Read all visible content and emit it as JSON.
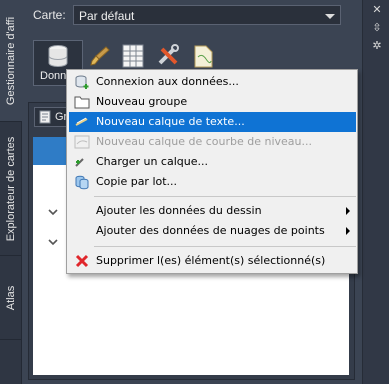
{
  "side_tabs": [
    {
      "label": "Gestionnaire d'affi"
    },
    {
      "label": "Explorateur de cartes"
    },
    {
      "label": "Atlas"
    }
  ],
  "map": {
    "label": "Carte:",
    "selected": "Par défaut"
  },
  "toolbar": {
    "data_button_label": "Donn",
    "group_button_label": "Gr"
  },
  "context_menu": {
    "items": [
      {
        "label": "Connexion aux données...",
        "icon": "database-connect-icon",
        "state": "normal"
      },
      {
        "label": "Nouveau groupe",
        "icon": "folder-icon",
        "state": "normal"
      },
      {
        "label": "Nouveau calque de texte...",
        "icon": "text-layer-icon",
        "state": "highlighted"
      },
      {
        "label": "Nouveau calque de courbe de niveau...",
        "icon": "contour-layer-icon",
        "state": "disabled"
      },
      {
        "label": "Charger un calque...",
        "icon": "load-layer-icon",
        "state": "normal"
      },
      {
        "label": "Copie par lot...",
        "icon": "batch-copy-icon",
        "state": "normal"
      },
      {
        "label": "Ajouter les données du dessin",
        "icon": "",
        "state": "submenu"
      },
      {
        "label": "Ajouter des données de nuages de points",
        "icon": "",
        "state": "submenu"
      },
      {
        "label": "Supprimer l(es) élément(s) sélectionné(s)",
        "icon": "delete-icon",
        "state": "normal"
      }
    ]
  },
  "colors": {
    "accent": "#0f73d4",
    "panel_bg": "#3b4453",
    "selection": "#2f7cc6",
    "delete": "#e0262b"
  }
}
